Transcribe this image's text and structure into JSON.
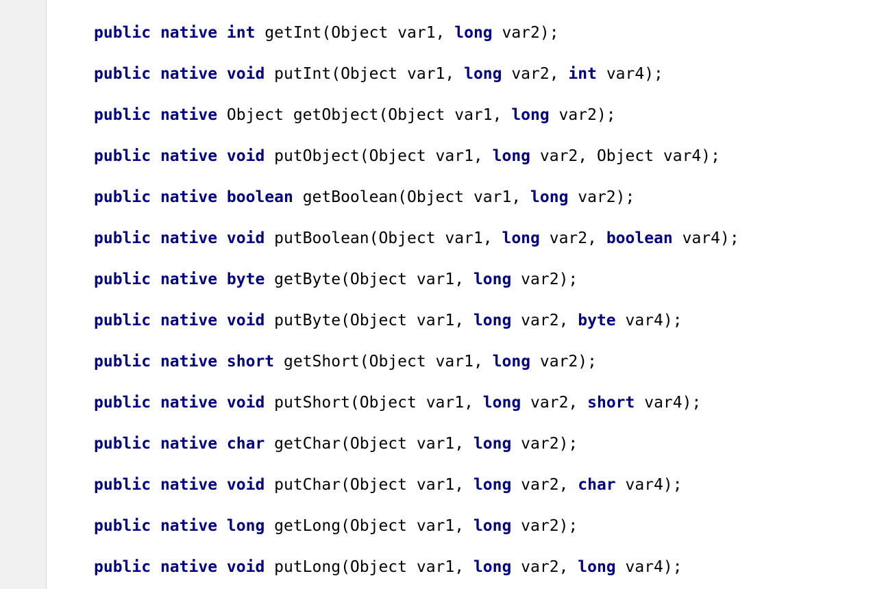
{
  "theme": {
    "keyword_color": "#000080",
    "text_color": "#000000",
    "gutter_color": "#f0f0f0",
    "background_color": "#ffffff"
  },
  "code": {
    "lines": [
      [
        {
          "t": "public",
          "k": 1
        },
        {
          "t": " "
        },
        {
          "t": "native",
          "k": 1
        },
        {
          "t": " "
        },
        {
          "t": "int",
          "k": 1
        },
        {
          "t": " getInt(Object var1, "
        },
        {
          "t": "long",
          "k": 1
        },
        {
          "t": " var2);"
        }
      ],
      [
        {
          "t": "public",
          "k": 1
        },
        {
          "t": " "
        },
        {
          "t": "native",
          "k": 1
        },
        {
          "t": " "
        },
        {
          "t": "void",
          "k": 1
        },
        {
          "t": " putInt(Object var1, "
        },
        {
          "t": "long",
          "k": 1
        },
        {
          "t": " var2, "
        },
        {
          "t": "int",
          "k": 1
        },
        {
          "t": " var4);"
        }
      ],
      [
        {
          "t": "public",
          "k": 1
        },
        {
          "t": " "
        },
        {
          "t": "native",
          "k": 1
        },
        {
          "t": " Object getObject(Object var1, "
        },
        {
          "t": "long",
          "k": 1
        },
        {
          "t": " var2);"
        }
      ],
      [
        {
          "t": "public",
          "k": 1
        },
        {
          "t": " "
        },
        {
          "t": "native",
          "k": 1
        },
        {
          "t": " "
        },
        {
          "t": "void",
          "k": 1
        },
        {
          "t": " putObject(Object var1, "
        },
        {
          "t": "long",
          "k": 1
        },
        {
          "t": " var2, Object var4);"
        }
      ],
      [
        {
          "t": "public",
          "k": 1
        },
        {
          "t": " "
        },
        {
          "t": "native",
          "k": 1
        },
        {
          "t": " "
        },
        {
          "t": "boolean",
          "k": 1
        },
        {
          "t": " getBoolean(Object var1, "
        },
        {
          "t": "long",
          "k": 1
        },
        {
          "t": " var2);"
        }
      ],
      [
        {
          "t": "public",
          "k": 1
        },
        {
          "t": " "
        },
        {
          "t": "native",
          "k": 1
        },
        {
          "t": " "
        },
        {
          "t": "void",
          "k": 1
        },
        {
          "t": " putBoolean(Object var1, "
        },
        {
          "t": "long",
          "k": 1
        },
        {
          "t": " var2, "
        },
        {
          "t": "boolean",
          "k": 1
        },
        {
          "t": " var4);"
        }
      ],
      [
        {
          "t": "public",
          "k": 1
        },
        {
          "t": " "
        },
        {
          "t": "native",
          "k": 1
        },
        {
          "t": " "
        },
        {
          "t": "byte",
          "k": 1
        },
        {
          "t": " getByte(Object var1, "
        },
        {
          "t": "long",
          "k": 1
        },
        {
          "t": " var2);"
        }
      ],
      [
        {
          "t": "public",
          "k": 1
        },
        {
          "t": " "
        },
        {
          "t": "native",
          "k": 1
        },
        {
          "t": " "
        },
        {
          "t": "void",
          "k": 1
        },
        {
          "t": " putByte(Object var1, "
        },
        {
          "t": "long",
          "k": 1
        },
        {
          "t": " var2, "
        },
        {
          "t": "byte",
          "k": 1
        },
        {
          "t": " var4);"
        }
      ],
      [
        {
          "t": "public",
          "k": 1
        },
        {
          "t": " "
        },
        {
          "t": "native",
          "k": 1
        },
        {
          "t": " "
        },
        {
          "t": "short",
          "k": 1
        },
        {
          "t": " getShort(Object var1, "
        },
        {
          "t": "long",
          "k": 1
        },
        {
          "t": " var2);"
        }
      ],
      [
        {
          "t": "public",
          "k": 1
        },
        {
          "t": " "
        },
        {
          "t": "native",
          "k": 1
        },
        {
          "t": " "
        },
        {
          "t": "void",
          "k": 1
        },
        {
          "t": " putShort(Object var1, "
        },
        {
          "t": "long",
          "k": 1
        },
        {
          "t": " var2, "
        },
        {
          "t": "short",
          "k": 1
        },
        {
          "t": " var4);"
        }
      ],
      [
        {
          "t": "public",
          "k": 1
        },
        {
          "t": " "
        },
        {
          "t": "native",
          "k": 1
        },
        {
          "t": " "
        },
        {
          "t": "char",
          "k": 1
        },
        {
          "t": " getChar(Object var1, "
        },
        {
          "t": "long",
          "k": 1
        },
        {
          "t": " var2);"
        }
      ],
      [
        {
          "t": "public",
          "k": 1
        },
        {
          "t": " "
        },
        {
          "t": "native",
          "k": 1
        },
        {
          "t": " "
        },
        {
          "t": "void",
          "k": 1
        },
        {
          "t": " putChar(Object var1, "
        },
        {
          "t": "long",
          "k": 1
        },
        {
          "t": " var2, "
        },
        {
          "t": "char",
          "k": 1
        },
        {
          "t": " var4);"
        }
      ],
      [
        {
          "t": "public",
          "k": 1
        },
        {
          "t": " "
        },
        {
          "t": "native",
          "k": 1
        },
        {
          "t": " "
        },
        {
          "t": "long",
          "k": 1
        },
        {
          "t": " getLong(Object var1, "
        },
        {
          "t": "long",
          "k": 1
        },
        {
          "t": " var2);"
        }
      ],
      [
        {
          "t": "public",
          "k": 1
        },
        {
          "t": " "
        },
        {
          "t": "native",
          "k": 1
        },
        {
          "t": " "
        },
        {
          "t": "void",
          "k": 1
        },
        {
          "t": " putLong(Object var1, "
        },
        {
          "t": "long",
          "k": 1
        },
        {
          "t": " var2, "
        },
        {
          "t": "long",
          "k": 1
        },
        {
          "t": " var4);"
        }
      ]
    ]
  }
}
